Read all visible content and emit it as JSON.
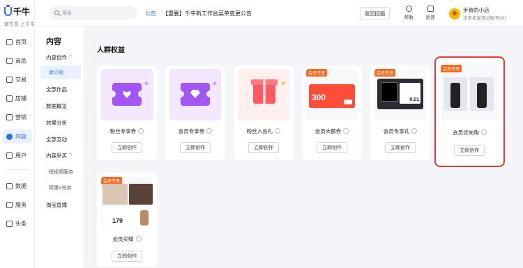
{
  "brand": {
    "name": "千牛",
    "slogan": "做生意,上千牛"
  },
  "rail": [
    {
      "label": "首页",
      "icon": "home-icon"
    },
    {
      "label": "商品",
      "icon": "goods-icon"
    },
    {
      "label": "交易",
      "icon": "trade-icon"
    },
    {
      "label": "店铺",
      "icon": "shop-icon"
    },
    {
      "label": "营销",
      "icon": "marketing-icon"
    },
    {
      "label": "内容",
      "icon": "content-icon",
      "active": true
    },
    {
      "label": "用户",
      "icon": "user-icon"
    },
    {
      "label": "数据",
      "icon": "data-icon"
    },
    {
      "label": "服务",
      "icon": "service-icon"
    },
    {
      "label": "头条",
      "icon": "news-icon"
    }
  ],
  "submenu": {
    "title": "内容",
    "items": [
      {
        "label": "内容创作",
        "caret": "^"
      },
      {
        "label": "发订阅",
        "active": true
      },
      {
        "label": "全部作品"
      },
      {
        "label": "数据概览"
      },
      {
        "label": "效果分析"
      },
      {
        "label": "全部互动"
      },
      {
        "label": "内容采买",
        "caret": "^"
      },
      {
        "label": "短视频服务",
        "small": true
      },
      {
        "label": "阿里V任务",
        "small": true
      },
      {
        "label": "淘宝直播"
      }
    ]
  },
  "topbar": {
    "search_placeholder": "搜索",
    "notice_tag": "公告",
    "notice_text": "【重要】千牛新工作台菜单变更公告",
    "back_old": "返回旧版",
    "help": "帮助",
    "feedback": "反馈",
    "shop_name": "步青的小店",
    "shop_sub": "步青卖家测试账号001"
  },
  "main": {
    "title": "人群权益",
    "cards": [
      {
        "name": "粉丝专享券",
        "button": "立即创作"
      },
      {
        "name": "会员专享券",
        "button": "立即创作"
      },
      {
        "name": "粉丝入会礼",
        "button": "立即创作"
      },
      {
        "name": "会员大额券",
        "button": "立即创作",
        "tag": "会员专享",
        "amount": "300"
      },
      {
        "name": "会员专享礼",
        "button": "立即创作",
        "tag": "会员专享",
        "price": "0.01"
      },
      {
        "name": "会员优先购",
        "button": "立即创作",
        "tag": "会员专享",
        "selected": true
      },
      {
        "name": "会员买赠",
        "button": "立即创作",
        "tag": "会员专享",
        "price": "179"
      }
    ]
  },
  "colors": {
    "accent": "#2f6bff",
    "tag": "#ff6a1f",
    "highlight": "#e53935"
  }
}
